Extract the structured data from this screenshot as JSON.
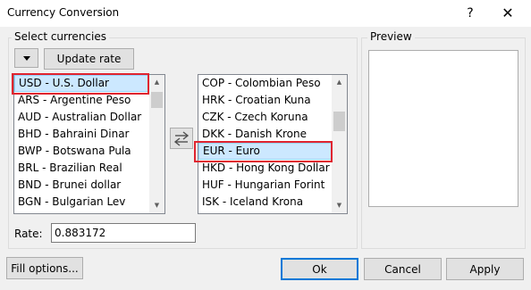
{
  "window": {
    "title": "Currency Conversion",
    "help_glyph": "?",
    "close_glyph": "✕"
  },
  "select_group": {
    "label": "Select currencies",
    "update_rate_label": "Update rate"
  },
  "preview_group": {
    "label": "Preview"
  },
  "from_list": {
    "items": [
      "USD - U.S. Dollar",
      "ARS - Argentine Peso",
      "AUD - Australian Dollar",
      "BHD - Bahraini Dinar",
      "BWP - Botswana Pula",
      "BRL - Brazilian Real",
      "BND - Brunei dollar",
      "BGN - Bulgarian Lev"
    ],
    "selected_index": 0
  },
  "to_list": {
    "items": [
      "COP - Colombian Peso",
      "HRK - Croatian Kuna",
      "CZK - Czech Koruna",
      "DKK - Danish Krone",
      "EUR - Euro",
      "HKD - Hong Kong Dollar",
      "HUF - Hungarian Forint",
      "ISK - Iceland Krona"
    ],
    "selected_index": 4
  },
  "rate": {
    "label": "Rate:",
    "value": "0.883172"
  },
  "buttons": {
    "fill_options": "Fill options...",
    "ok": "Ok",
    "cancel": "Cancel",
    "apply": "Apply"
  },
  "colors": {
    "highlight": "#e0242f",
    "selection": "#cce8ff",
    "default_button_border": "#0078d7"
  },
  "icons": {
    "dropdown": "chevron-down-icon",
    "swap": "swap-arrows-icon"
  }
}
